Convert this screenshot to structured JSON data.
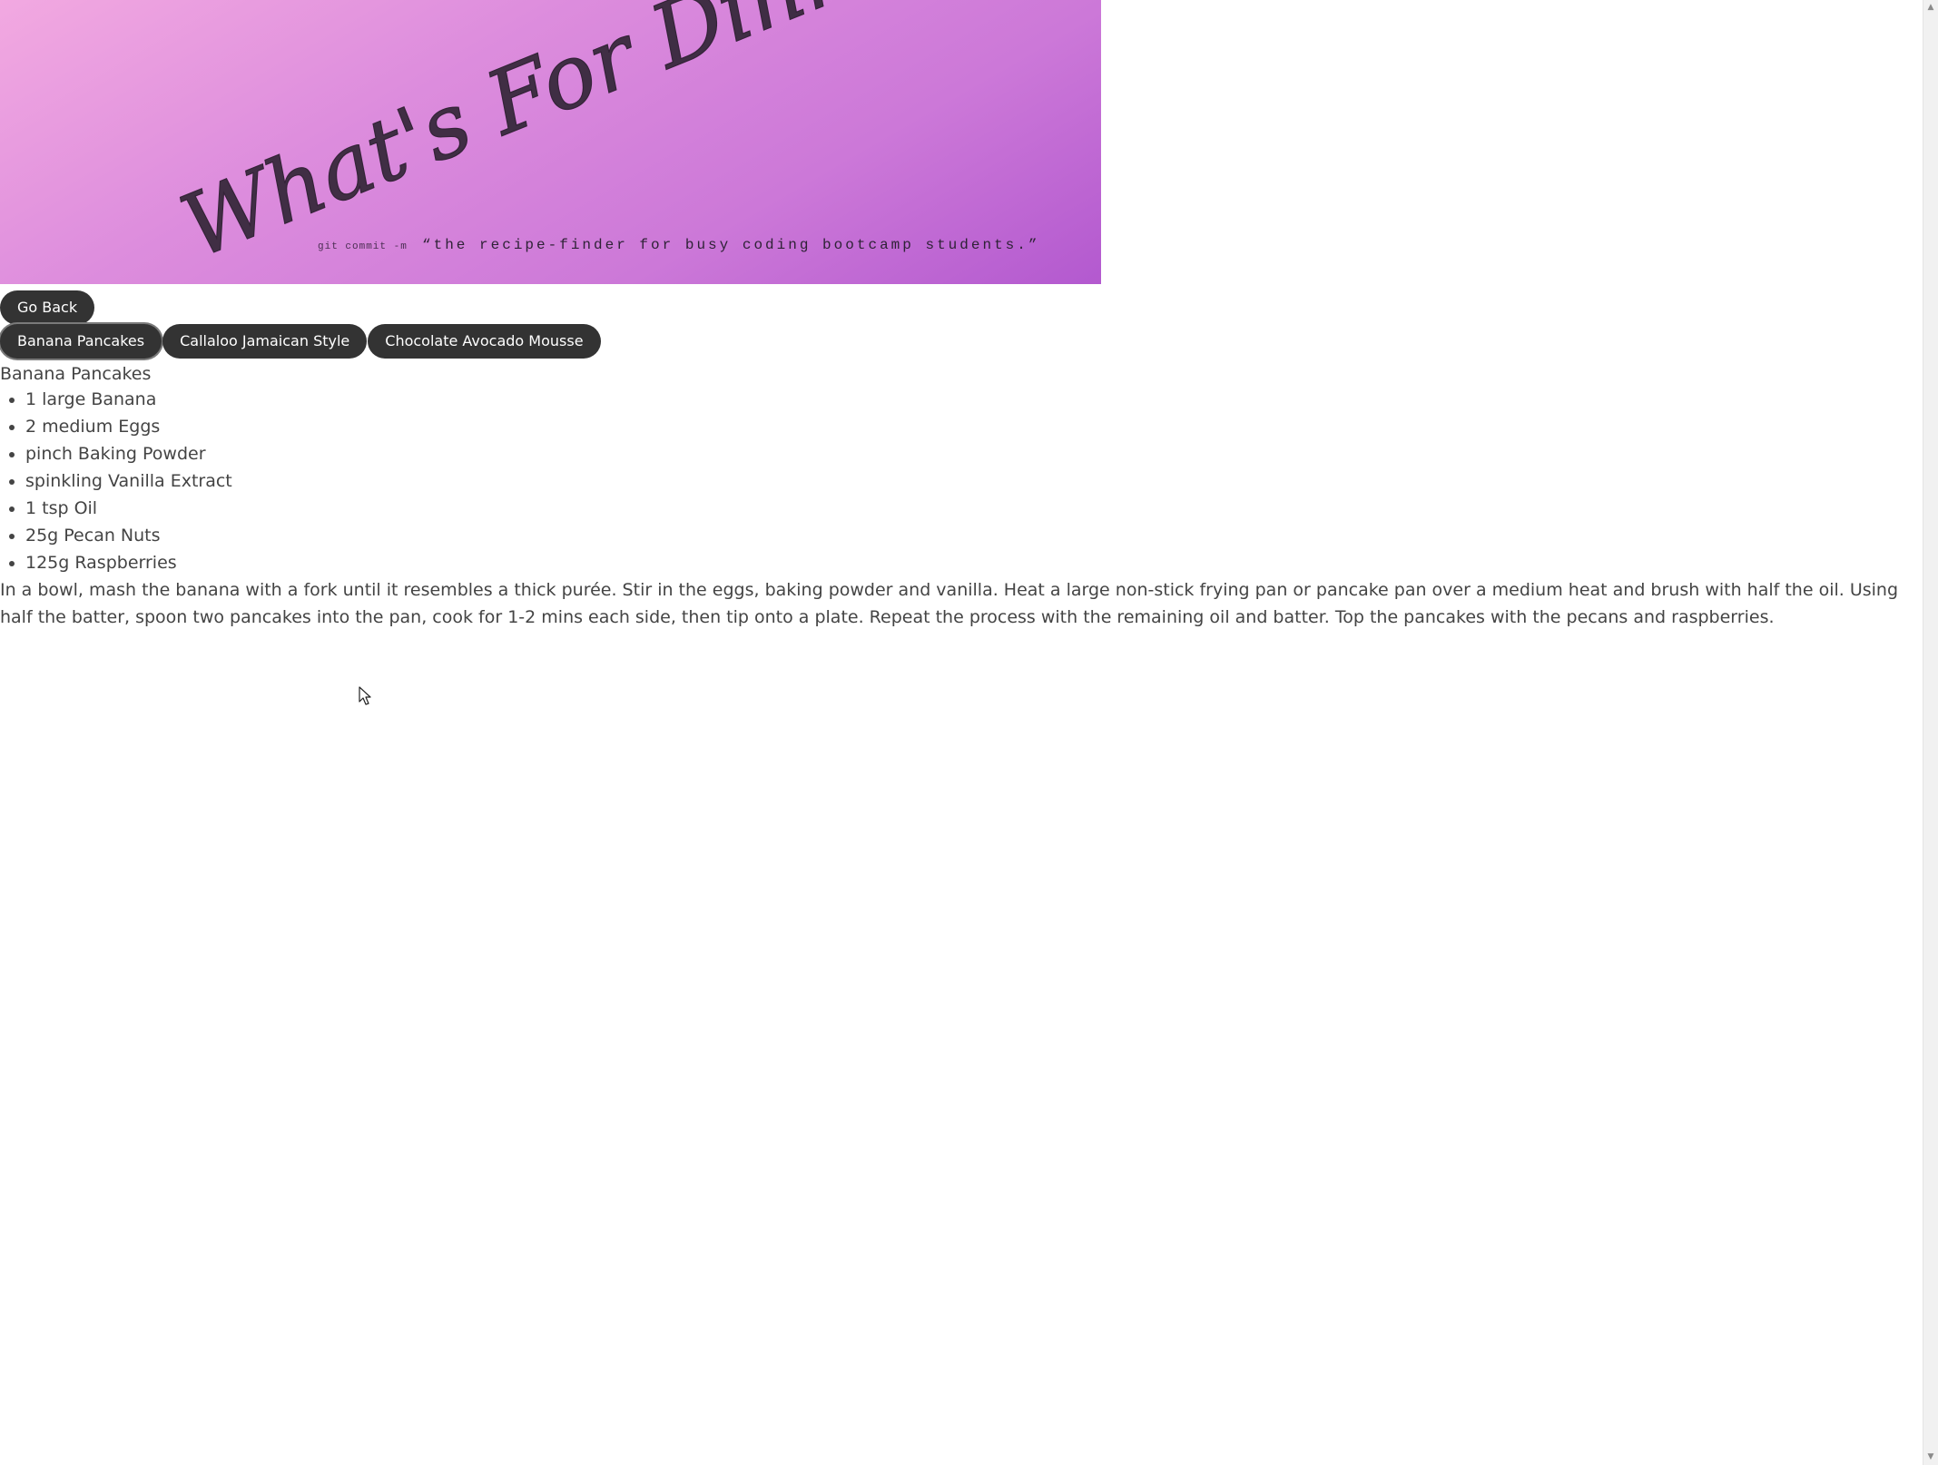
{
  "banner": {
    "title": "What's For Dinner?",
    "tagline_prefix": "git commit -m",
    "tagline": "“the recipe-finder for busy coding bootcamp students.”"
  },
  "nav": {
    "back_label": "Go Back"
  },
  "recipe_tabs": [
    {
      "label": "Banana Pancakes"
    },
    {
      "label": "Callaloo Jamaican Style"
    },
    {
      "label": "Chocolate Avocado Mousse"
    }
  ],
  "recipe": {
    "title": "Banana Pancakes",
    "ingredients": [
      "1 large Banana",
      "2 medium Eggs",
      "pinch Baking Powder",
      "spinkling Vanilla Extract",
      "1 tsp Oil",
      "25g Pecan Nuts",
      "125g Raspberries"
    ],
    "method": "In a bowl, mash the banana with a fork until it resembles a thick purée. Stir in the eggs, baking powder and vanilla. Heat a large non-stick frying pan or pancake pan over a medium heat and brush with half the oil. Using half the batter, spoon two pancakes into the pan, cook for 1-2 mins each side, then tip onto a plate. Repeat the process with the remaining oil and batter. Top the pancakes with the pecans and raspberries."
  },
  "scrollbar": {
    "up_icon": "triangle-up-icon",
    "down_icon": "triangle-down-icon"
  },
  "colors": {
    "banner_start": "#f2a9e1",
    "banner_end": "#b359cf",
    "button_bg": "#333333",
    "button_text": "#ffffff",
    "body_text": "#444444"
  }
}
